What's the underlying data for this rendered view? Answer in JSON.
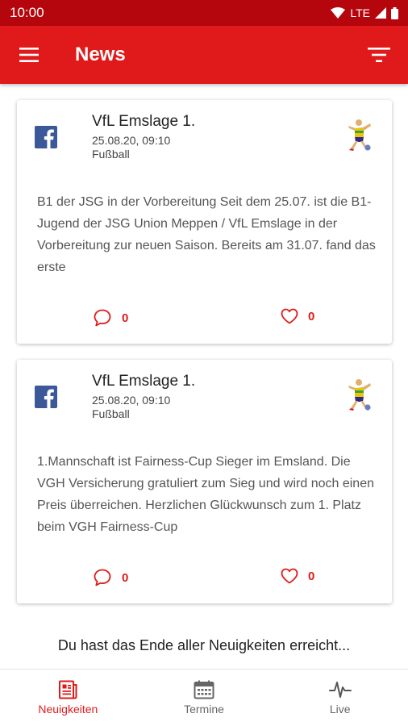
{
  "status_bar": {
    "time": "10:00",
    "network": "LTE"
  },
  "app_bar": {
    "title": "News",
    "menu_icon": "menu-icon",
    "filter_icon": "filter-icon"
  },
  "posts": [
    {
      "author": "VfL Emslage 1.",
      "date": "25.08.20, 09:10",
      "category": "Fußball",
      "text": "B1 der JSG in der Vorbereitung Seit dem 25.07. ist die B1-Jugend der JSG Union Meppen / VfL Emslage in der Vorbereitung zur neuen Saison. Bereits am 31.07. fand das erste",
      "comments": "0",
      "likes": "0"
    },
    {
      "author": "VfL Emslage 1.",
      "date": "25.08.20, 09:10",
      "category": "Fußball",
      "text": "1.Mannschaft ist Fairness-Cup Sieger im Emsland. Die VGH Versicherung gratuliert zum Sieg und wird noch einen Preis überreichen. Herzlichen Glückwunsch zum 1. Platz beim VGH Fairness-Cup",
      "comments": "0",
      "likes": "0"
    }
  ],
  "end_message": "Du hast das Ende aller Neuigkeiten erreicht...",
  "bottom_nav": [
    {
      "label": "Neuigkeiten",
      "icon": "news-icon",
      "active": true
    },
    {
      "label": "Termine",
      "icon": "calendar-icon",
      "active": false
    },
    {
      "label": "Live",
      "icon": "live-pulse-icon",
      "active": false
    }
  ],
  "colors": {
    "primary": "#e01a1a",
    "status_bar": "#b5060d",
    "facebook": "#3b5998"
  }
}
